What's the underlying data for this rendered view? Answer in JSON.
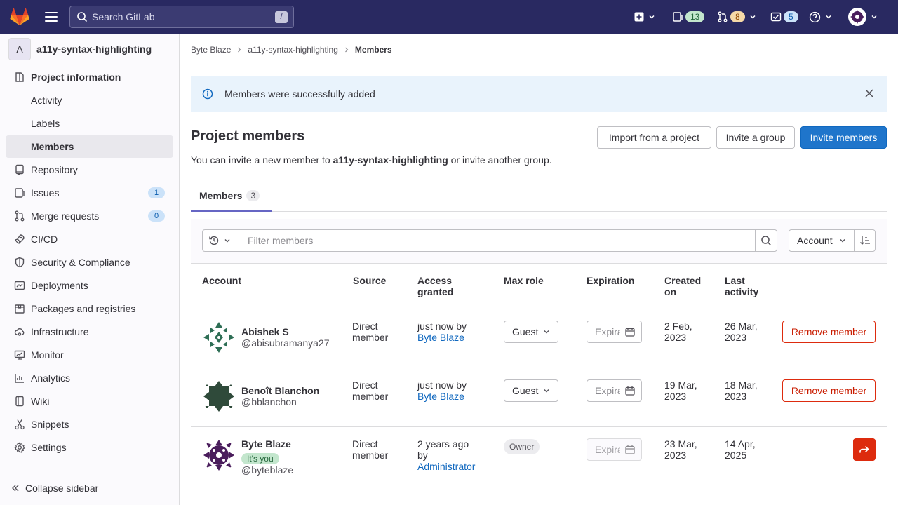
{
  "topbar": {
    "search_placeholder": "Search GitLab",
    "search_shortcut": "/",
    "issues_count": "13",
    "merge_requests_count": "8",
    "todos_count": "5"
  },
  "sidebar": {
    "project_initial": "A",
    "project_name": "a11y-syntax-highlighting",
    "items": [
      {
        "label": "Project information"
      },
      {
        "label": "Activity"
      },
      {
        "label": "Labels"
      },
      {
        "label": "Members"
      },
      {
        "label": "Repository"
      },
      {
        "label": "Issues",
        "badge": "1"
      },
      {
        "label": "Merge requests",
        "badge": "0"
      },
      {
        "label": "CI/CD"
      },
      {
        "label": "Security & Compliance"
      },
      {
        "label": "Deployments"
      },
      {
        "label": "Packages and registries"
      },
      {
        "label": "Infrastructure"
      },
      {
        "label": "Monitor"
      },
      {
        "label": "Analytics"
      },
      {
        "label": "Wiki"
      },
      {
        "label": "Snippets"
      },
      {
        "label": "Settings"
      }
    ],
    "collapse_label": "Collapse sidebar"
  },
  "breadcrumb": [
    "Byte Blaze",
    "a11y-syntax-highlighting",
    "Members"
  ],
  "alert": {
    "text": "Members were successfully added"
  },
  "page": {
    "title": "Project members",
    "invite_prefix": "You can invite a new member to ",
    "invite_project": "a11y-syntax-highlighting",
    "invite_suffix": " or invite another group.",
    "import_button": "Import from a project",
    "invite_group_button": "Invite a group",
    "invite_members_button": "Invite members"
  },
  "tabs": [
    {
      "label": "Members",
      "count": "3"
    }
  ],
  "filter": {
    "placeholder": "Filter members",
    "sort_label": "Account"
  },
  "table": {
    "headers": {
      "account": "Account",
      "source": "Source",
      "access_granted_1": "Access",
      "access_granted_2": "granted",
      "max_role": "Max role",
      "expiration": "Expiration",
      "created_1": "Created",
      "created_2": "on",
      "last_activity_1": "Last",
      "last_activity_2": "activity"
    },
    "rows": [
      {
        "name": "Abishek S",
        "handle": "@abisubramanya27",
        "source_1": "Direct",
        "source_2": "member",
        "access_1": "just now by",
        "access_by": "Byte Blaze",
        "role": "Guest",
        "expiration_placeholder": "Expiration",
        "created_1": "2 Feb,",
        "created_2": "2023",
        "activity_1": "26 Mar,",
        "activity_2": "2023",
        "action": "Remove member"
      },
      {
        "name": "Benoît Blanchon",
        "handle": "@bblanchon",
        "source_1": "Direct",
        "source_2": "member",
        "access_1": "just now by",
        "access_by": "Byte Blaze",
        "role": "Guest",
        "expiration_placeholder": "Expiration",
        "created_1": "19 Mar,",
        "created_2": "2023",
        "activity_1": "18 Mar,",
        "activity_2": "2023",
        "action": "Remove member"
      },
      {
        "name": "Byte Blaze",
        "badge": "It's you",
        "handle": "@byteblaze",
        "source_1": "Direct",
        "source_2": "member",
        "access_1": "2 years ago",
        "access_2": "by",
        "access_by": "Administrator",
        "role": "Owner",
        "expiration_placeholder": "Expiration",
        "created_1": "23 Mar,",
        "created_2": "2023",
        "activity_1": "14 Apr,",
        "activity_2": "2025"
      }
    ]
  },
  "colors": {
    "topbar_bg": "#292961",
    "primary": "#1f75cb",
    "danger": "#dd2b0e",
    "link": "#1068bf"
  }
}
